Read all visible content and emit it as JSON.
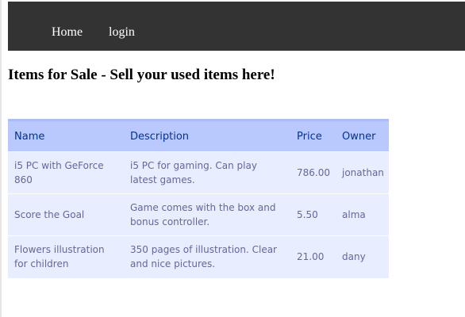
{
  "nav": {
    "home_label": "Home",
    "login_label": "login"
  },
  "page": {
    "title": "Items for Sale - Sell your used items here!"
  },
  "table": {
    "headers": {
      "name": "Name",
      "description": "Description",
      "price": "Price",
      "owner": "Owner"
    },
    "rows": [
      {
        "name": "i5 PC with GeForce 860",
        "description": "i5 PC for gaming. Can play latest games.",
        "price": "786.00",
        "owner": "jonathan"
      },
      {
        "name": "Score the Goal",
        "description": "Game comes with the box and bonus controller.",
        "price": "5.50",
        "owner": "alma"
      },
      {
        "name": "Flowers illustration for children",
        "description": "350 pages of illustration. Clear and nice pictures.",
        "price": "21.00",
        "owner": "dany"
      }
    ]
  },
  "colors": {
    "navbar_bg": "#333333",
    "table_header_bg": "#b9c9fe",
    "table_header_text": "#003399",
    "table_row_bg": "#e8edff",
    "table_row_text": "#666699"
  }
}
